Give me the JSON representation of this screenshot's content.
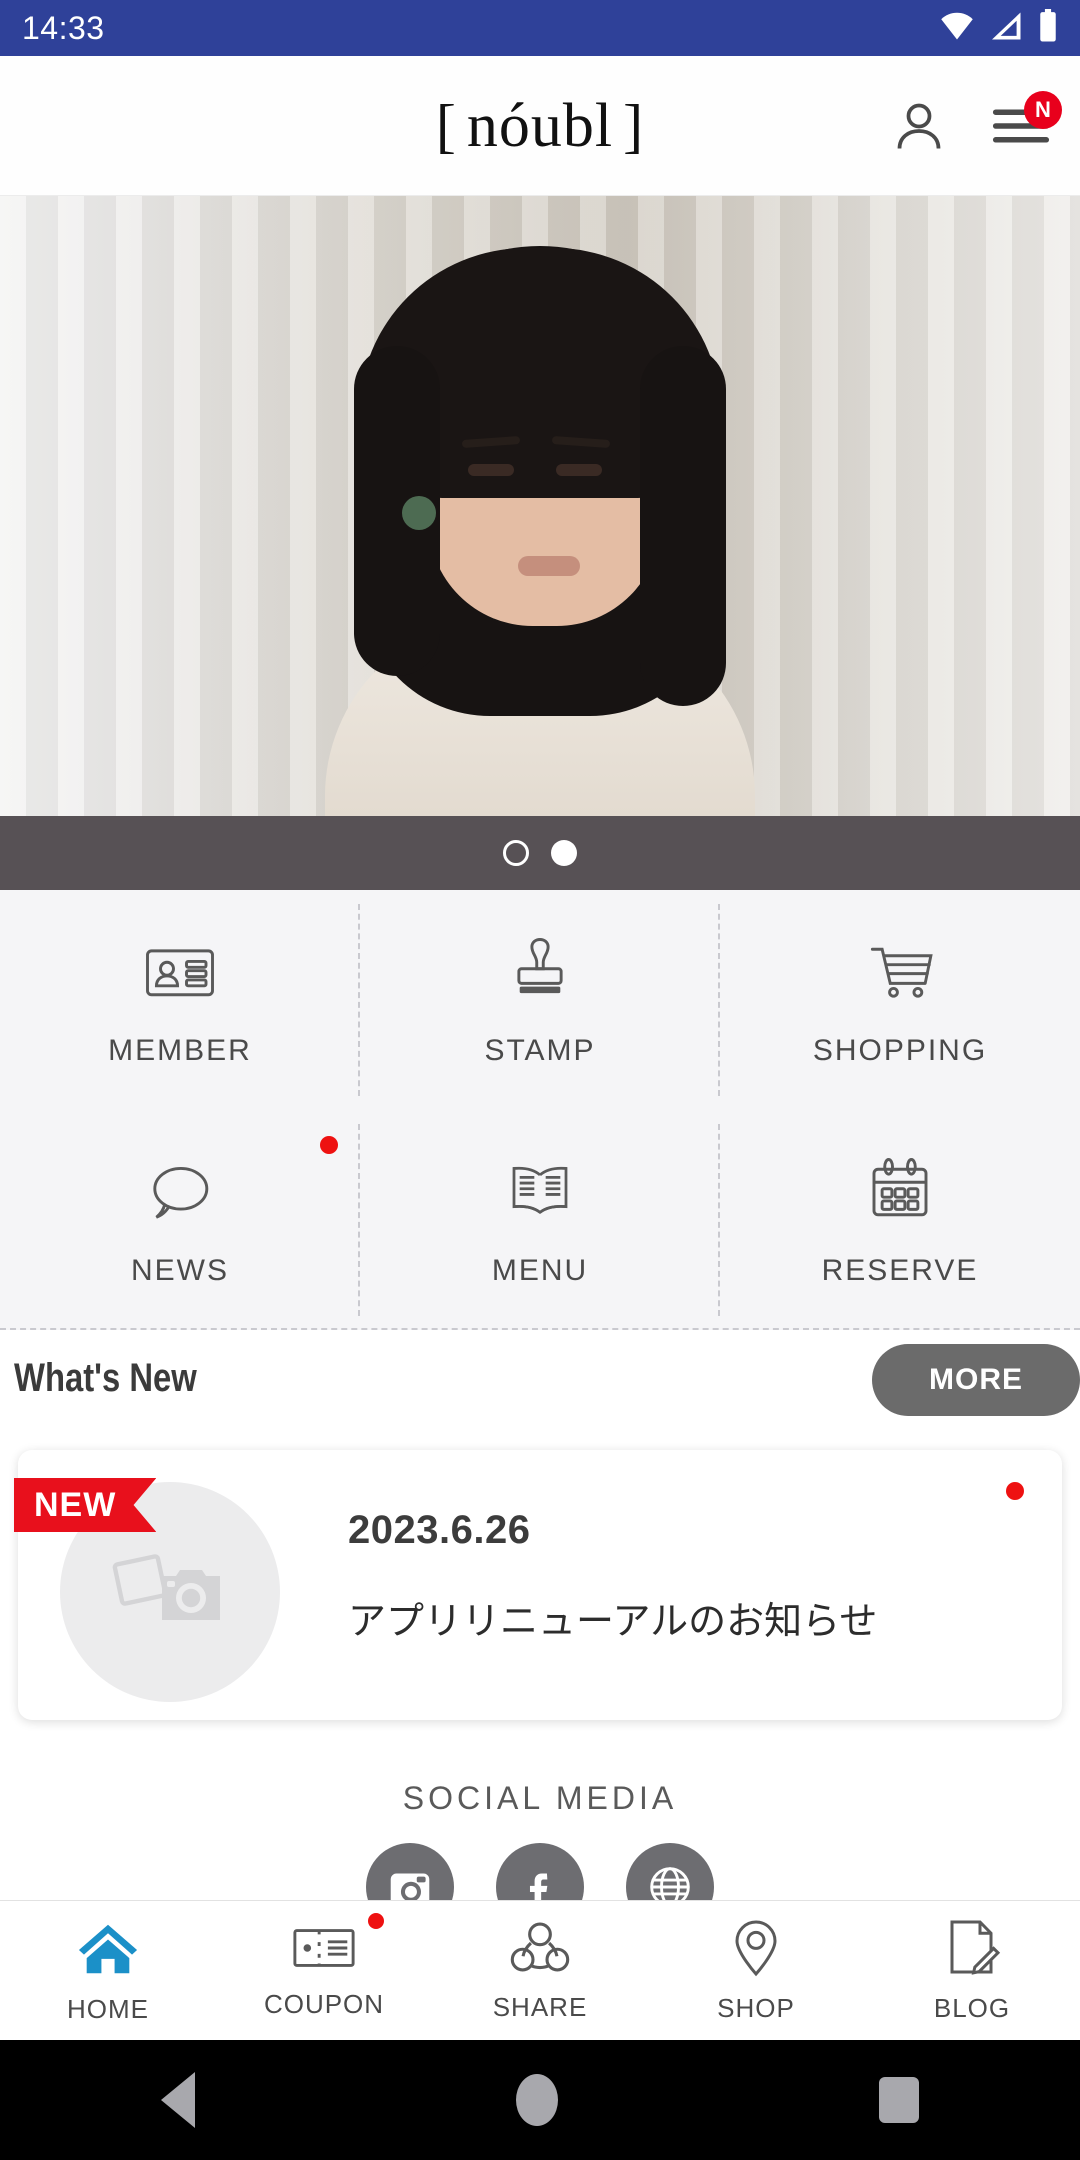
{
  "statusbar": {
    "time": "14:33",
    "icons": [
      "wifi-icon",
      "signal-icon",
      "battery-icon"
    ]
  },
  "header": {
    "logo_open": "[",
    "logo_text": "nóubl",
    "logo_close": "]",
    "account_icon": "person-icon",
    "menu_icon": "hamburger-menu-icon",
    "menu_badge": "N",
    "badge_color": "#e8001c"
  },
  "hero": {
    "alt": "woman-portrait-banner",
    "carousel": {
      "total": 2,
      "active_index": 1,
      "bar_color": "#575155"
    }
  },
  "grid": {
    "items": [
      {
        "label": "MEMBER",
        "icon": "id-card-icon",
        "badge": false
      },
      {
        "label": "STAMP",
        "icon": "stamp-icon",
        "badge": false
      },
      {
        "label": "SHOPPING",
        "icon": "shopping-cart-icon",
        "badge": false
      },
      {
        "label": "NEWS",
        "icon": "speech-bubble-icon",
        "badge": true
      },
      {
        "label": "MENU",
        "icon": "open-book-icon",
        "badge": false
      },
      {
        "label": "RESERVE",
        "icon": "calendar-icon",
        "badge": false
      }
    ],
    "badge_color": "#ee1111"
  },
  "whats_new": {
    "title": "What's New",
    "more_label": "MORE",
    "items": [
      {
        "badge": "NEW",
        "date": "2023.6.26",
        "title": "アプリリニューアルのお知らせ",
        "thumb_icon": "photo-camera-placeholder-icon",
        "unread": true
      }
    ]
  },
  "social": {
    "title": "SOCIAL MEDIA",
    "items": [
      {
        "name": "instagram-icon"
      },
      {
        "name": "facebook-icon"
      },
      {
        "name": "website-globe-icon"
      }
    ]
  },
  "tabbar": {
    "active": "HOME",
    "accent_color": "#1b90c8",
    "items": [
      {
        "label": "HOME",
        "icon": "home-icon",
        "active": true,
        "badge": false
      },
      {
        "label": "COUPON",
        "icon": "ticket-icon",
        "active": false,
        "badge": true
      },
      {
        "label": "SHARE",
        "icon": "share-icon",
        "active": false,
        "badge": false
      },
      {
        "label": "SHOP",
        "icon": "map-pin-icon",
        "active": false,
        "badge": false
      },
      {
        "label": "BLOG",
        "icon": "document-pencil-icon",
        "active": false,
        "badge": false
      }
    ]
  },
  "navbar": {
    "back": "back-triangle-icon",
    "home": "home-circle-icon",
    "recents": "recents-square-icon"
  }
}
